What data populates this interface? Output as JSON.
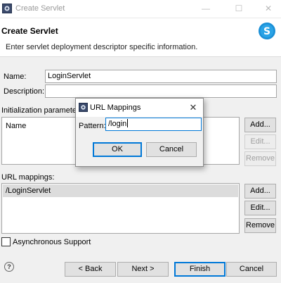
{
  "window": {
    "title": "Create Servlet",
    "controls": {
      "minimize": "—",
      "maximize": "☐",
      "close": "✕"
    }
  },
  "header": {
    "title": "Create Servlet",
    "description": "Enter servlet deployment descriptor specific information."
  },
  "form": {
    "name_label": "Name:",
    "name_value": "LoginServlet",
    "description_label": "Description:",
    "description_value": "",
    "init_params_label": "Initialization paramete",
    "init_params_column": "Name",
    "init_buttons": {
      "add": "Add...",
      "edit": "Edit...",
      "remove": "Remove"
    },
    "url_mappings_label": "URL mappings:",
    "url_mappings_items": [
      "/LoginServlet"
    ],
    "url_buttons": {
      "add": "Add...",
      "edit": "Edit...",
      "remove": "Remove"
    },
    "async_label": "Asynchronous Support",
    "async_checked": false
  },
  "footer": {
    "help": "?",
    "back": "< Back",
    "next": "Next >",
    "finish": "Finish",
    "cancel": "Cancel"
  },
  "dialog": {
    "title": "URL Mappings",
    "close": "✕",
    "pattern_label": "Pattern:",
    "pattern_value": "/login",
    "ok": "OK",
    "cancel": "Cancel"
  },
  "colors": {
    "accent": "#0078d7",
    "logo": "#1a8fd6"
  }
}
